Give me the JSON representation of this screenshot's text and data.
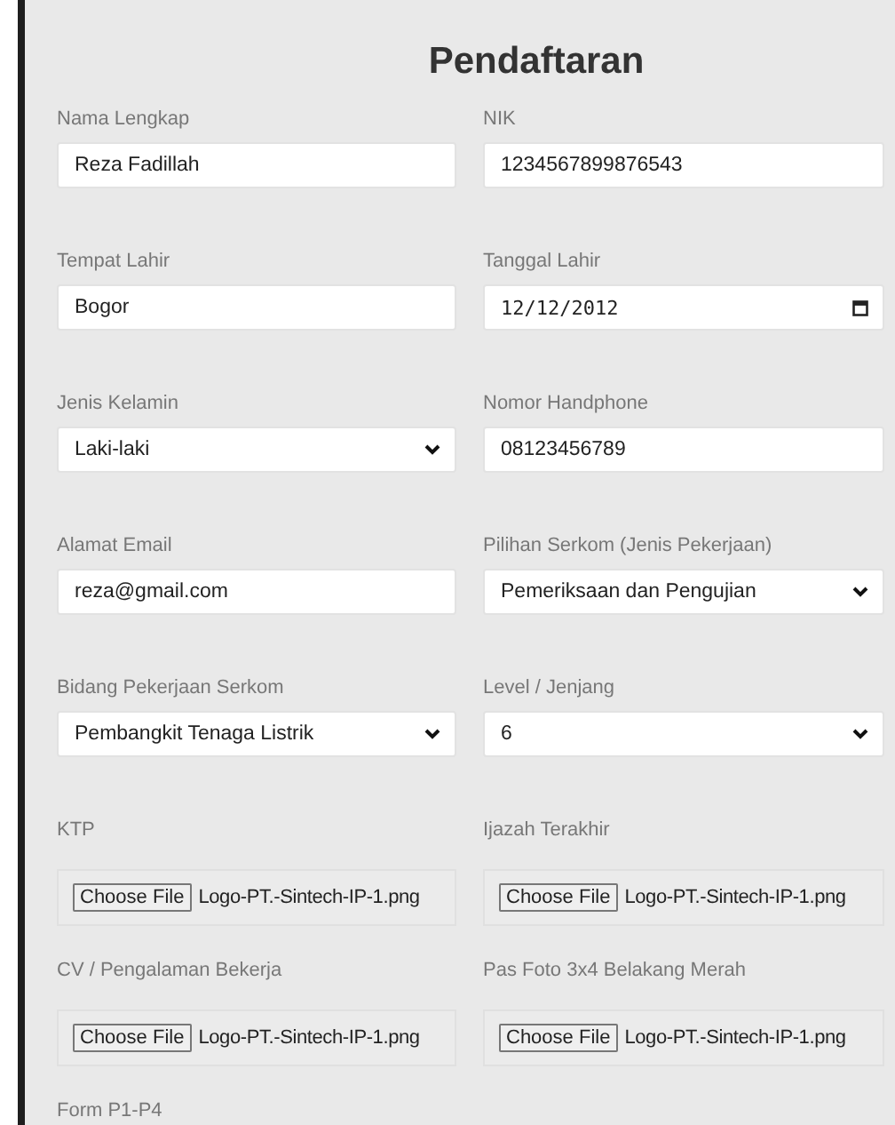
{
  "title": "Pendaftaran",
  "fields": [
    {
      "label": "Nama Lengkap",
      "kind": "text",
      "value": "Reza Fadillah"
    },
    {
      "label": "NIK",
      "kind": "text",
      "value": "1234567899876543"
    },
    {
      "label": "Tempat Lahir",
      "kind": "text",
      "value": "Bogor"
    },
    {
      "label": "Tanggal Lahir",
      "kind": "date",
      "value": "12/12/2012"
    },
    {
      "label": "Jenis Kelamin",
      "kind": "select",
      "value": "Laki-laki"
    },
    {
      "label": "Nomor Handphone",
      "kind": "text",
      "value": "08123456789"
    },
    {
      "label": "Alamat Email",
      "kind": "text",
      "value": "reza@gmail.com"
    },
    {
      "label": "Pilihan Serkom (Jenis Pekerjaan)",
      "kind": "select",
      "value": "Pemeriksaan dan Pengujian"
    },
    {
      "label": "Bidang Pekerjaan Serkom",
      "kind": "select",
      "value": "Pembangkit Tenaga Listrik"
    },
    {
      "label": "Level / Jenjang",
      "kind": "select",
      "value": "6"
    },
    {
      "label": "KTP",
      "kind": "file",
      "button": "Choose File",
      "value": "Logo-PT.-Sintech-IP-1.png"
    },
    {
      "label": "Ijazah Terakhir",
      "kind": "file",
      "button": "Choose File",
      "value": "Logo-PT.-Sintech-IP-1.png"
    },
    {
      "label": "CV / Pengalaman Bekerja",
      "kind": "file",
      "button": "Choose File",
      "value": "Logo-PT.-Sintech-IP-1.png"
    },
    {
      "label": "Pas Foto 3x4 Belakang Merah",
      "kind": "file",
      "button": "Choose File",
      "value": "Logo-PT.-Sintech-IP-1.png"
    },
    {
      "label": "Form P1-P4",
      "kind": "cut"
    }
  ]
}
